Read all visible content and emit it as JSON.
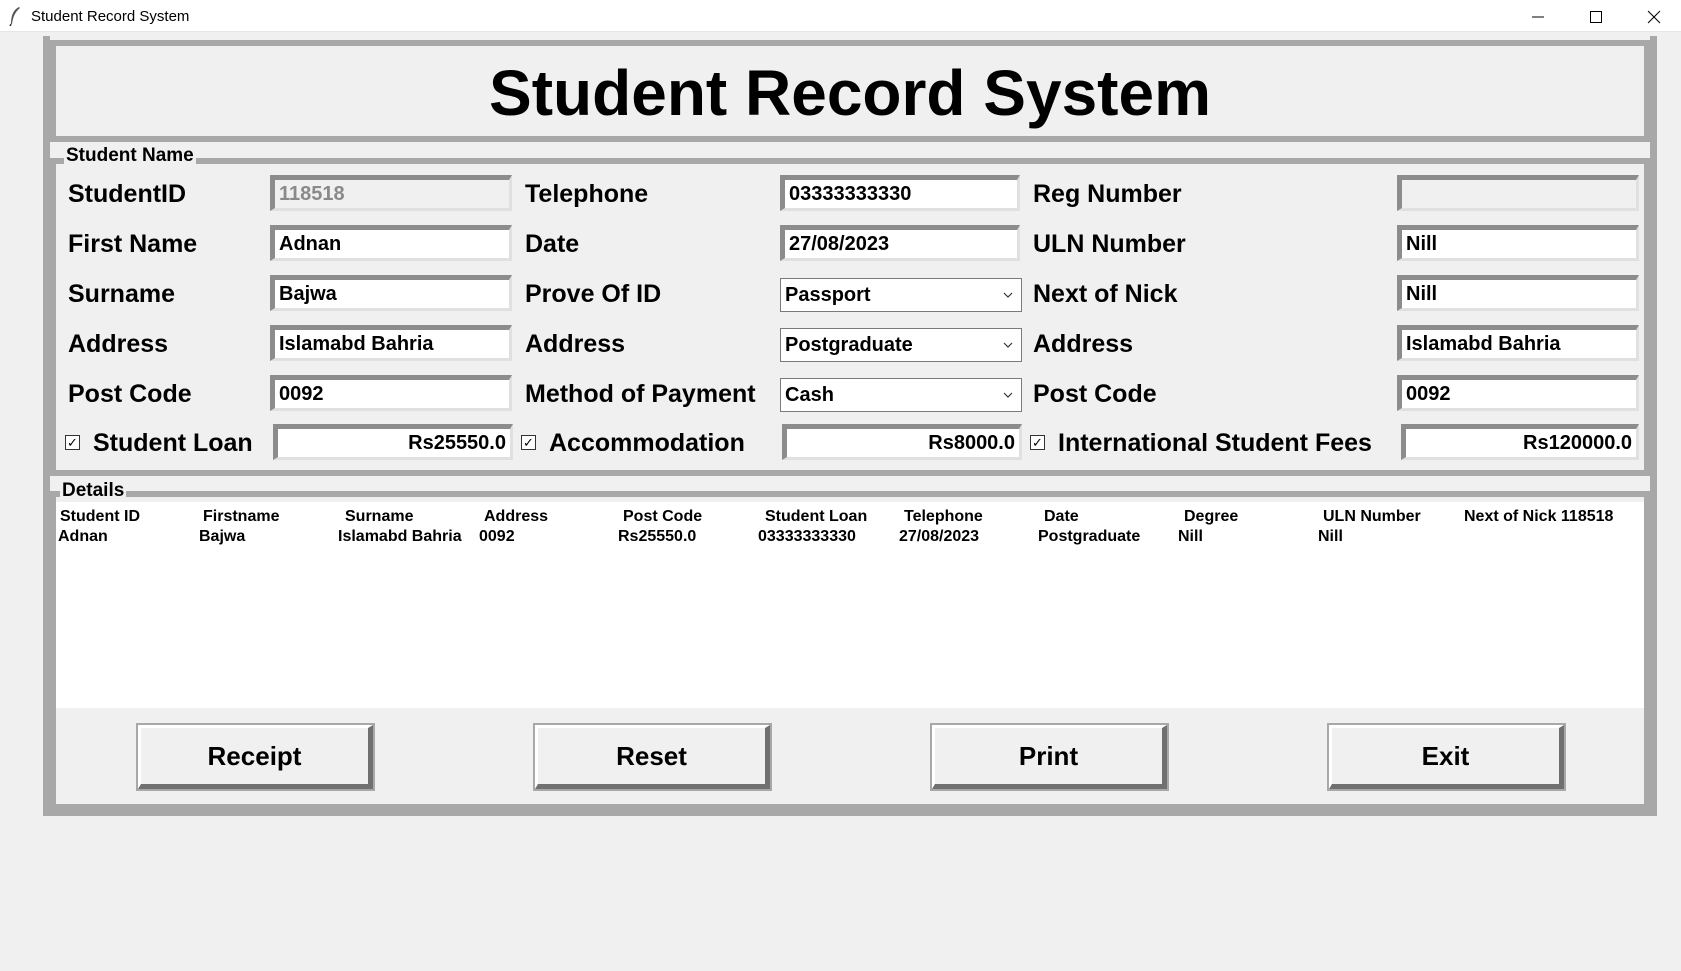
{
  "window": {
    "title": "Student Record System",
    "icon": "feather-icon",
    "controls": [
      "minimize-icon",
      "maximize-icon",
      "close-icon"
    ]
  },
  "header": {
    "title": "Student Record System"
  },
  "student_group": {
    "label": "Student Name",
    "col1": {
      "student_id": {
        "label": "StudentID",
        "value": "118518"
      },
      "first_name": {
        "label": "First Name",
        "value": "Adnan"
      },
      "surname": {
        "label": "Surname",
        "value": "Bajwa"
      },
      "address": {
        "label": "Address",
        "value": "Islamabd Bahria"
      },
      "post_code": {
        "label": "Post Code",
        "value": "0092"
      },
      "student_loan": {
        "label": "Student Loan",
        "checked": true,
        "value": "Rs25550.0"
      }
    },
    "col2": {
      "telephone": {
        "label": "Telephone",
        "value": "03333333330"
      },
      "date": {
        "label": "Date",
        "value": "27/08/2023"
      },
      "prove_of_id": {
        "label": "Prove Of ID",
        "value": "Passport"
      },
      "address": {
        "label": "Address",
        "value": "Postgraduate"
      },
      "method_of_payment": {
        "label": "Method of Payment",
        "value": "Cash"
      },
      "accommodation": {
        "label": "Accommodation",
        "checked": true,
        "value": "Rs8000.0"
      }
    },
    "col3": {
      "reg_number": {
        "label": "Reg Number",
        "value": ""
      },
      "uln_number": {
        "label": "ULN Number",
        "value": "Nill"
      },
      "next_of_nick": {
        "label": "Next of Nick",
        "value": "Nill"
      },
      "address": {
        "label": "Address",
        "value": "Islamabd Bahria"
      },
      "post_code": {
        "label": "Post Code",
        "value": "0092"
      },
      "international_fees": {
        "label": "International Student Fees",
        "checked": true,
        "value": "Rs120000.0"
      }
    }
  },
  "details": {
    "label": "Details",
    "headers": [
      "Student ID",
      "Firstname",
      "Surname",
      "Address",
      "Post Code",
      "Student Loan",
      "Telephone",
      "Date",
      "Degree",
      "ULN Number",
      "Next of Nick 118518"
    ],
    "row": [
      "Adnan",
      "Bajwa",
      "Islamabd Bahria",
      "0092",
      "Rs25550.0",
      "03333333330",
      "27/08/2023",
      "Postgraduate",
      "Nill",
      "Nill"
    ]
  },
  "buttons": {
    "receipt": "Receipt",
    "reset": "Reset",
    "print": "Print",
    "exit": "Exit"
  }
}
